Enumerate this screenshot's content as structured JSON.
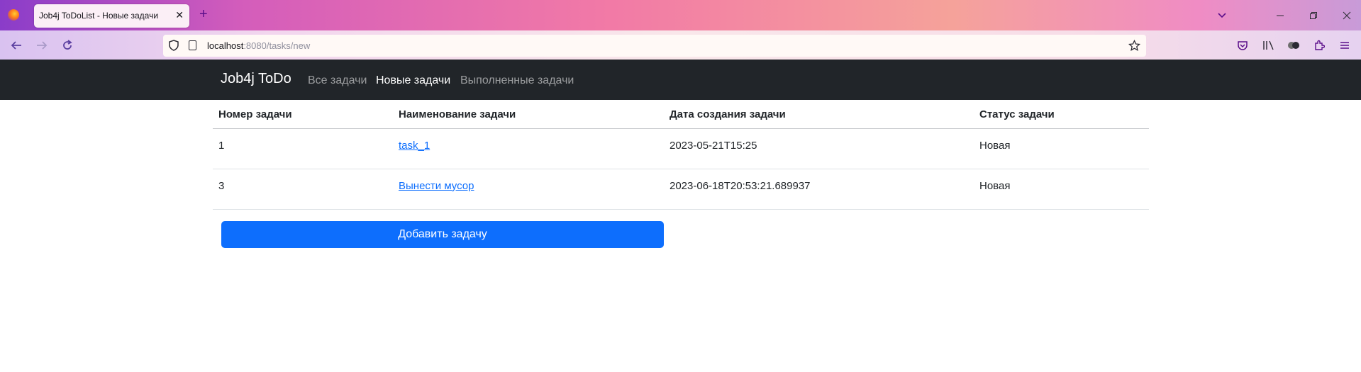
{
  "browser": {
    "tab_title": "Job4j ToDoList - Новые задачи",
    "tab_close": "✕",
    "new_tab": "+",
    "url_host": "localhost",
    "url_rest": ":8080/tasks/new"
  },
  "navbar": {
    "brand": "Job4j ToDo",
    "links": [
      {
        "label": "Все задачи",
        "active": false
      },
      {
        "label": "Новые задачи",
        "active": true
      },
      {
        "label": "Выполненные задачи",
        "active": false
      }
    ]
  },
  "table": {
    "headers": [
      "Номер задачи",
      "Наименование задачи",
      "Дата создания задачи",
      "Статус задачи"
    ],
    "rows": [
      {
        "id": "1",
        "name": "task_1",
        "created": "2023-05-21T15:25",
        "status": "Новая"
      },
      {
        "id": "3",
        "name": "Вынести мусор",
        "created": "2023-06-18T20:53:21.689937",
        "status": "Новая"
      }
    ]
  },
  "add_button_label": "Добавить задачу",
  "colors": {
    "navbar_bg": "#212529",
    "primary": "#0d6efd",
    "link": "#0d6efd"
  }
}
